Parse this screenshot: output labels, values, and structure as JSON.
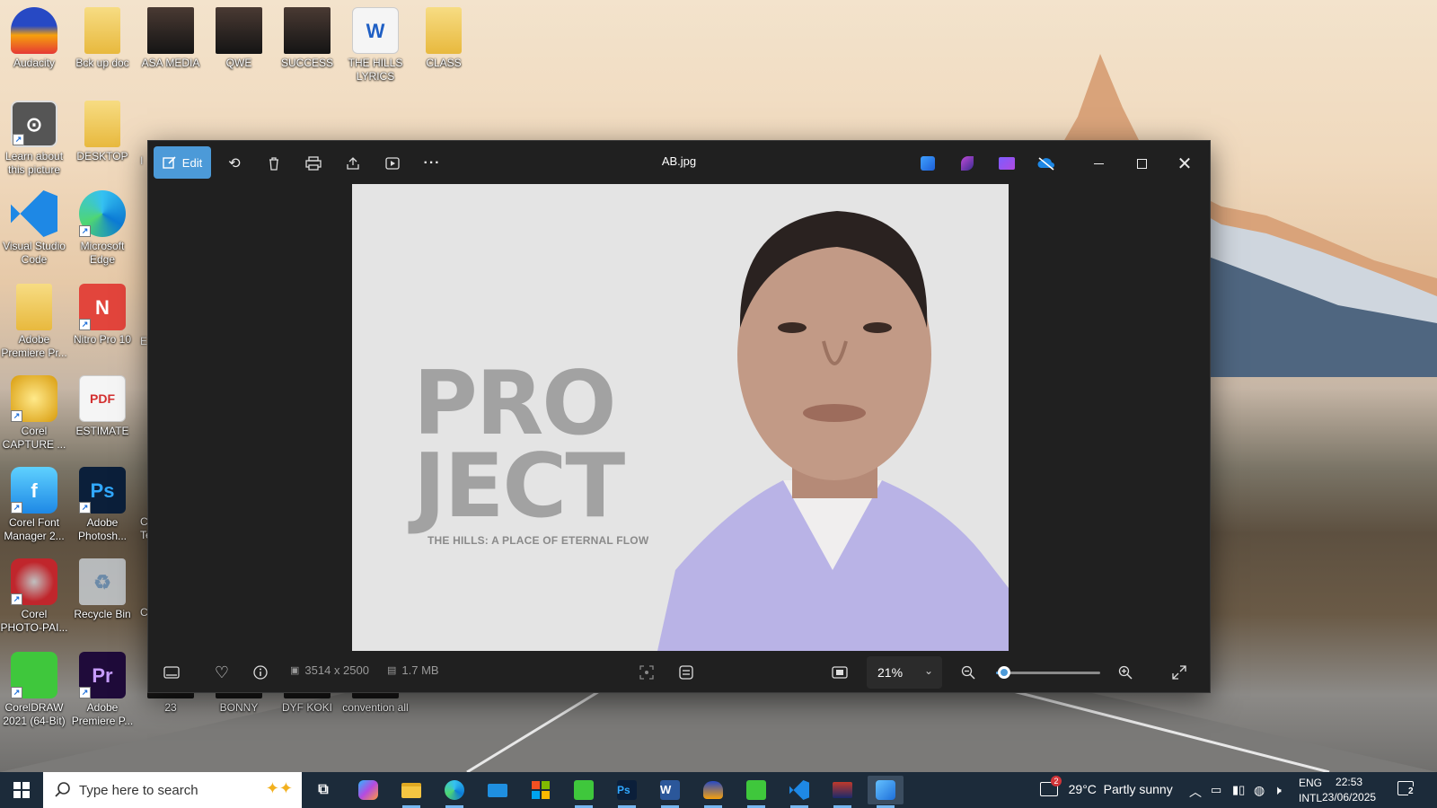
{
  "desktop": {
    "icons": [
      {
        "label": "Audacity",
        "icon": "audacity-icon"
      },
      {
        "label": "Bck up doc",
        "icon": "folder-icon"
      },
      {
        "label": "ASA MEDIA",
        "icon": "image-file-icon"
      },
      {
        "label": "QWE",
        "icon": "image-file-icon"
      },
      {
        "label": "SUCCESS",
        "icon": "image-file-icon"
      },
      {
        "label": "THE HILLS LYRICS",
        "icon": "word-document-icon"
      },
      {
        "label": "CLASS",
        "icon": "folder-icon"
      },
      {
        "label": "Learn about this picture",
        "icon": "learn-picture-icon"
      },
      {
        "label": "DESKTOP",
        "icon": "folder-icon"
      },
      {
        "label": "Visual Studio Code",
        "icon": "vscode-icon"
      },
      {
        "label": "Microsoft Edge",
        "icon": "edge-icon"
      },
      {
        "label": "Adobe Premiere Pr...",
        "icon": "folder-icon"
      },
      {
        "label": "Nitro Pro 10",
        "icon": "nitro-icon"
      },
      {
        "label": "Corel CAPTURE ...",
        "icon": "corel-capture-icon"
      },
      {
        "label": "ESTIMATE",
        "icon": "pdf-icon"
      },
      {
        "label": "Corel Font Manager 2...",
        "icon": "corel-font-icon"
      },
      {
        "label": "Adobe Photosh...",
        "icon": "photoshop-icon"
      },
      {
        "label": "Corel PHOTO-PAI...",
        "icon": "corel-photopaint-icon"
      },
      {
        "label": "Recycle Bin",
        "icon": "recycle-bin-icon"
      },
      {
        "label": "CorelDRAW 2021 (64-Bit)",
        "icon": "coreldraw-icon"
      },
      {
        "label": "Adobe Premiere P...",
        "icon": "premiere-icon"
      },
      {
        "label": "23",
        "icon": "image-file-icon"
      },
      {
        "label": "BONNY",
        "icon": "image-file-icon"
      },
      {
        "label": "DYF KOKI",
        "icon": "image-file-icon"
      },
      {
        "label": "convention all",
        "icon": "image-file-icon"
      }
    ],
    "partial_labels": [
      "I",
      "E",
      "C",
      "Te",
      "C"
    ]
  },
  "window": {
    "title": "AB.jpg",
    "edit_label": "Edit",
    "more_label": "···",
    "photo": {
      "headline_line1": "PRO",
      "headline_line2": "JECT",
      "subtitle": "THE HILLS: A PLACE OF ETERNAL FLOW"
    },
    "status": {
      "dimensions": "3514 x 2500",
      "file_size": "1.7 MB",
      "zoom": "21%",
      "zoom_fraction": 0.08
    }
  },
  "taskbar": {
    "search_placeholder": "Type here to search",
    "weather": "29°C  Partly sunny",
    "weather_badge": "2",
    "language_top": "ENG",
    "language_bottom": "INTL",
    "time": "22:53",
    "date": "23/06/2025",
    "notification_count": "2",
    "ps_label": "Ps",
    "word_label": "W"
  },
  "colors": {
    "accent": "#4c9ad8",
    "window_bg": "#202020",
    "taskbar_bg": "#1c2b3a"
  }
}
